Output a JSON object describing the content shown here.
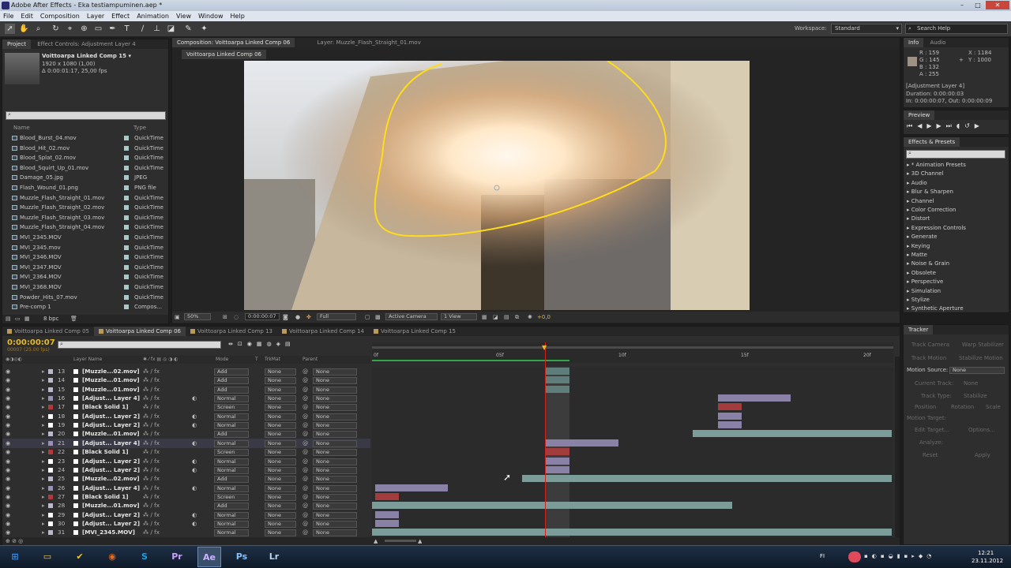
{
  "window": {
    "title": "Adobe After Effects - Eka testiampuminen.aep *",
    "min": "–",
    "max": "□",
    "close": "✕"
  },
  "menu": [
    "File",
    "Edit",
    "Composition",
    "Layer",
    "Effect",
    "Animation",
    "View",
    "Window",
    "Help"
  ],
  "toolbar": {
    "workspace_label": "Workspace:",
    "workspace_value": "Standard",
    "search_placeholder": "Search Help"
  },
  "project": {
    "tabs": [
      "Project",
      "Effect Controls: Adjustment Layer 4"
    ],
    "comp_name": "Voittoarpa Linked Comp 15 ▾",
    "comp_info1": "1920 x 1080 (1,00)",
    "comp_info2": "Δ 0:00:01:17, 25,00 fps",
    "col_name": "Name",
    "col_type": "Type",
    "items": [
      {
        "name": "Blood_Burst_04.mov",
        "type": "QuickTime"
      },
      {
        "name": "Blood_Hit_02.mov",
        "type": "QuickTime"
      },
      {
        "name": "Blood_Splat_02.mov",
        "type": "QuickTime"
      },
      {
        "name": "Blood_Squirt_Up_01.mov",
        "type": "QuickTime"
      },
      {
        "name": "Damage_05.jpg",
        "type": "JPEG"
      },
      {
        "name": "Flash_Wound_01.png",
        "type": "PNG file"
      },
      {
        "name": "Muzzle_Flash_Straight_01.mov",
        "type": "QuickTime"
      },
      {
        "name": "Muzzle_Flash_Straight_02.mov",
        "type": "QuickTime"
      },
      {
        "name": "Muzzle_Flash_Straight_03.mov",
        "type": "QuickTime"
      },
      {
        "name": "Muzzle_Flash_Straight_04.mov",
        "type": "QuickTime"
      },
      {
        "name": "MVI_2345.MOV",
        "type": "QuickTime"
      },
      {
        "name": "MVI_2345.mov",
        "type": "QuickTime"
      },
      {
        "name": "MVI_2346.MOV",
        "type": "QuickTime"
      },
      {
        "name": "MVI_2347.MOV",
        "type": "QuickTime"
      },
      {
        "name": "MVI_2364.MOV",
        "type": "QuickTime"
      },
      {
        "name": "MVI_2368.MOV",
        "type": "QuickTime"
      },
      {
        "name": "Powder_Hits_07.mov",
        "type": "QuickTime"
      },
      {
        "name": "Pre-comp 1",
        "type": "Compos..."
      }
    ],
    "bpc": "8 bpc"
  },
  "composition": {
    "tabs": [
      "Composition: Voittoarpa Linked Comp 06",
      "Layer: Muzzle_Flash_Straight_01.mov"
    ],
    "subtab": "Voittoarpa Linked Comp 06",
    "zoom": "50%",
    "timecode": "0:00:00:07",
    "resolution": "Full",
    "camera": "Active Camera",
    "view": "1 View",
    "exposure": "+0,0"
  },
  "info": {
    "tabs": [
      "Info",
      "Audio"
    ],
    "r": "R : 159",
    "g": "G : 145",
    "b": "B : 132",
    "a": "A : 255",
    "x": "X : 1184",
    "y": "Y : 1000",
    "layer": "[Adjustment Layer 4]",
    "duration": "Duration: 0:00:00:03",
    "inout": "In: 0:00:00:07, Out: 0:00:00:09",
    "swatch": "#9f9184"
  },
  "preview": {
    "tab": "Preview"
  },
  "effects": {
    "tab": "Effects & Presets",
    "items": [
      "* Animation Presets",
      "3D Channel",
      "Audio",
      "Blur & Sharpen",
      "Channel",
      "Color Correction",
      "Distort",
      "Expression Controls",
      "Generate",
      "Keying",
      "Matte",
      "Noise & Grain",
      "Obsolete",
      "Perspective",
      "Simulation",
      "Stylize",
      "Synthetic Aperture"
    ]
  },
  "tracker": {
    "tab": "Tracker",
    "buttons": [
      "Track Camera",
      "Warp Stabilizer",
      "Track Motion",
      "Stabilize Motion"
    ],
    "motion_source_label": "Motion Source:",
    "motion_source_value": "None",
    "current_track_label": "Current Track:",
    "current_track_value": "None",
    "track_type_label": "Track Type:",
    "track_type_value": "Stabilize",
    "position": "Position",
    "rotation": "Rotation",
    "scale": "Scale",
    "motion_target": "Motion Target:",
    "edit_target": "Edit Target...",
    "options": "Options...",
    "analyze": "Analyze:",
    "reset": "Reset",
    "apply": "Apply"
  },
  "timeline": {
    "tabs": [
      "Voittoarpa Linked Comp 05",
      "Voittoarpa Linked Comp 06",
      "Voittoarpa Linked Comp 13",
      "Voittoarpa Linked Comp 14",
      "Voittoarpa Linked Comp 15"
    ],
    "timecode": "0:00:00:07",
    "fps": "00007 (25.00 fps)",
    "col_layer": "Layer Name",
    "col_mode": "Mode",
    "col_t": "T",
    "col_trkmat": "TrkMat",
    "col_parent": "Parent",
    "ruler": [
      "0f",
      "05f",
      "10f",
      "15f",
      "20f"
    ],
    "layers": [
      {
        "num": "13",
        "name": "[Muzzle...02.mov]",
        "mode": "Add",
        "trk": "None",
        "parent": "None",
        "color": "#b9b9c9"
      },
      {
        "num": "14",
        "name": "[Muzzle...01.mov]",
        "mode": "Add",
        "trk": "None",
        "parent": "None",
        "color": "#b9b9c9"
      },
      {
        "num": "15",
        "name": "[Muzzle...01.mov]",
        "mode": "Add",
        "trk": "None",
        "parent": "None",
        "color": "#b9b9c9"
      },
      {
        "num": "16",
        "name": "[Adjust... Layer 4]",
        "mode": "Normal",
        "trk": "None",
        "parent": "None",
        "color": "#9a8fb5"
      },
      {
        "num": "17",
        "name": "[Black Solid 1]",
        "mode": "Screen",
        "trk": "None",
        "parent": "None",
        "color": "#b03a3a"
      },
      {
        "num": "18",
        "name": "[Adjust... Layer 2]",
        "mode": "Normal",
        "trk": "None",
        "parent": "None",
        "color": "#ffffff"
      },
      {
        "num": "19",
        "name": "[Adjust... Layer 2]",
        "mode": "Normal",
        "trk": "None",
        "parent": "None",
        "color": "#ffffff"
      },
      {
        "num": "20",
        "name": "[Muzzle...01.mov]",
        "mode": "Add",
        "trk": "None",
        "parent": "None",
        "color": "#b9b9c9"
      },
      {
        "num": "21",
        "name": "[Adjust... Layer 4]",
        "mode": "Normal",
        "trk": "None",
        "parent": "None",
        "color": "#9a8fb5"
      },
      {
        "num": "22",
        "name": "[Black Solid 1]",
        "mode": "Screen",
        "trk": "None",
        "parent": "None",
        "color": "#b03a3a"
      },
      {
        "num": "23",
        "name": "[Adjust... Layer 2]",
        "mode": "Normal",
        "trk": "None",
        "parent": "None",
        "color": "#ffffff"
      },
      {
        "num": "24",
        "name": "[Adjust... Layer 2]",
        "mode": "Normal",
        "trk": "None",
        "parent": "None",
        "color": "#ffffff"
      },
      {
        "num": "25",
        "name": "[Muzzle...02.mov]",
        "mode": "Add",
        "trk": "None",
        "parent": "None",
        "color": "#b9b9c9"
      },
      {
        "num": "26",
        "name": "[Adjust... Layer 4]",
        "mode": "Normal",
        "trk": "None",
        "parent": "None",
        "color": "#9a8fb5"
      },
      {
        "num": "27",
        "name": "[Black Solid 1]",
        "mode": "Screen",
        "trk": "None",
        "parent": "None",
        "color": "#b03a3a"
      },
      {
        "num": "28",
        "name": "[Muzzle...01.mov]",
        "mode": "Add",
        "trk": "None",
        "parent": "None",
        "color": "#b9b9c9"
      },
      {
        "num": "29",
        "name": "[Adjust... Layer 2]",
        "mode": "Normal",
        "trk": "None",
        "parent": "None",
        "color": "#ffffff"
      },
      {
        "num": "30",
        "name": "[Adjust... Layer 2]",
        "mode": "Normal",
        "trk": "None",
        "parent": "None",
        "color": "#ffffff"
      },
      {
        "num": "31",
        "name": "[MVI_2345.MOV]",
        "mode": "Normal",
        "trk": "None",
        "parent": "None",
        "color": "#b9b9c9"
      }
    ]
  },
  "taskbar": {
    "apps": [
      {
        "icon": "windows-start-icon",
        "label": "⊞",
        "color": "#3a8ee6"
      },
      {
        "icon": "explorer-icon",
        "label": "▭",
        "color": "#e8c15a"
      },
      {
        "icon": "norton-icon",
        "label": "✔",
        "color": "#f2c81a"
      },
      {
        "icon": "firefox-icon",
        "label": "◉",
        "color": "#e66a1e"
      },
      {
        "icon": "skype-icon",
        "label": "S",
        "color": "#17a1e6"
      },
      {
        "icon": "premiere-icon",
        "label": "Pr",
        "color": "#c9a2ff"
      },
      {
        "icon": "after-effects-icon",
        "label": "Ae",
        "color": "#cfb1ff"
      },
      {
        "icon": "photoshop-icon",
        "label": "Ps",
        "color": "#7fc1ff"
      },
      {
        "icon": "lightroom-icon",
        "label": "Lr",
        "color": "#b7d3f0"
      }
    ],
    "lang": "FI",
    "time": "12:21",
    "date": "23.11.2012"
  }
}
